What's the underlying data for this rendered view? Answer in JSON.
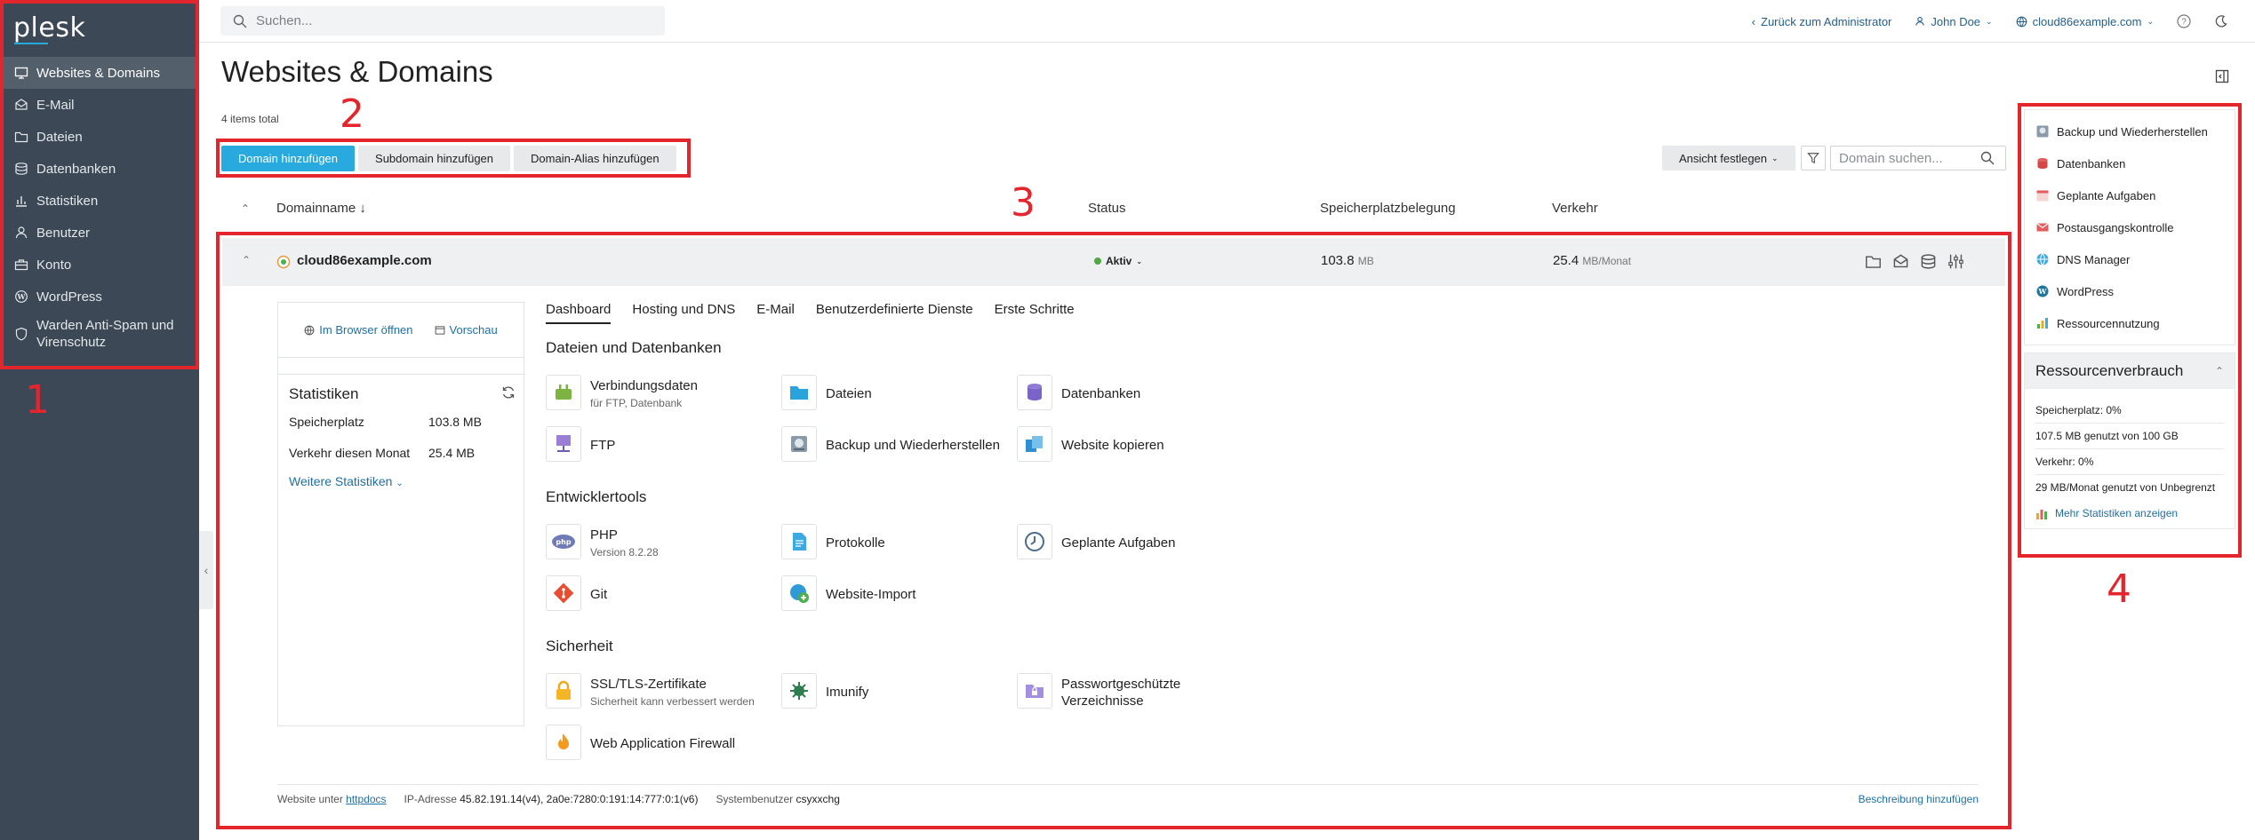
{
  "sidebar": {
    "logo": "plesk",
    "items": [
      {
        "label": "Websites & Domains"
      },
      {
        "label": "E-Mail"
      },
      {
        "label": "Dateien"
      },
      {
        "label": "Datenbanken"
      },
      {
        "label": "Statistiken"
      },
      {
        "label": "Benutzer"
      },
      {
        "label": "Konto"
      },
      {
        "label": "WordPress"
      },
      {
        "label": "Warden Anti-Spam und Virenschutz"
      }
    ]
  },
  "topbar": {
    "search_placeholder": "Suchen...",
    "back_admin": "Zurück zum Administrator",
    "user": "John Doe",
    "subscription": "cloud86example.com"
  },
  "page": {
    "title": "Websites & Domains",
    "items_total": "4 items total"
  },
  "toolbar": {
    "add_domain": "Domain hinzufügen",
    "add_subdomain": "Subdomain hinzufügen",
    "add_alias": "Domain-Alias hinzufügen",
    "view": "Ansicht festlegen",
    "domain_search_placeholder": "Domain suchen..."
  },
  "table": {
    "headers": {
      "name": "Domainname ↓",
      "status": "Status",
      "disk": "Speicherplatzbelegung",
      "traffic": "Verkehr"
    }
  },
  "domain": {
    "name": "cloud86example.com",
    "status": "Aktiv",
    "disk_value": "103.8",
    "disk_unit": "MB",
    "traffic_value": "25.4",
    "traffic_unit": "MB/Monat",
    "open_browser": "Im Browser öffnen",
    "preview": "Vorschau",
    "stats_title": "Statistiken",
    "stats": [
      {
        "label": "Speicherplatz",
        "value": "103.8 MB"
      },
      {
        "label": "Verkehr diesen Monat",
        "value": "25.4 MB"
      }
    ],
    "more_stats": "Weitere Statistiken",
    "tabs": [
      "Dashboard",
      "Hosting und DNS",
      "E-Mail",
      "Benutzerdefinierte Dienste",
      "Erste Schritte"
    ],
    "sections": {
      "files_db": "Dateien und Datenbanken",
      "dev": "Entwicklertools",
      "security": "Sicherheit"
    },
    "tools": {
      "connection": {
        "name": "Verbindungsdaten",
        "sub": "für FTP, Datenbank"
      },
      "files": {
        "name": "Dateien"
      },
      "databases": {
        "name": "Datenbanken"
      },
      "ftp": {
        "name": "FTP"
      },
      "backup": {
        "name": "Backup und Wiederherstellen"
      },
      "copy": {
        "name": "Website kopieren"
      },
      "php": {
        "name": "PHP",
        "sub": "Version 8.2.28"
      },
      "logs": {
        "name": "Protokolle"
      },
      "scheduled": {
        "name": "Geplante Aufgaben"
      },
      "git": {
        "name": "Git"
      },
      "import": {
        "name": "Website-Import"
      },
      "ssl": {
        "name": "SSL/TLS-Zertifikate",
        "sub": "Sicherheit kann verbessert werden"
      },
      "imunify": {
        "name": "Imunify"
      },
      "protected": {
        "name": "Passwortgeschützte Verzeichnisse"
      },
      "waf": {
        "name": "Web Application Firewall"
      }
    },
    "footer": {
      "site_under": "Website unter",
      "httpdocs": "httpdocs",
      "ip_label": "IP-Adresse",
      "ip_value": "45.82.191.14(v4), 2a0e:7280:0:191:14:777:0:1(v6)",
      "sysuser_label": "Systembenutzer",
      "sysuser_value": "csyxxchg",
      "add_description": "Beschreibung hinzufügen"
    }
  },
  "right_panel": {
    "links": [
      "Backup und Wiederherstellen",
      "Datenbanken",
      "Geplante Aufgaben",
      "Postausgangskontrolle",
      "DNS Manager",
      "WordPress",
      "Ressourcennutzung"
    ],
    "resources_title": "Ressourcenverbrauch",
    "disk_label": "Speicherplatz: 0%",
    "disk_detail": "107.5 MB genutzt von 100 GB",
    "traffic_label": "Verkehr: 0%",
    "traffic_detail": "29 MB/Monat genutzt von Unbegrenzt",
    "more_stats": "Mehr Statistiken anzeigen"
  },
  "annotations": [
    "1",
    "2",
    "3",
    "4"
  ],
  "colors": {
    "sidebar_bg": "#3c4855",
    "accent": "#28aade",
    "annotation_red": "#e3252d",
    "status_green": "#52a845"
  }
}
